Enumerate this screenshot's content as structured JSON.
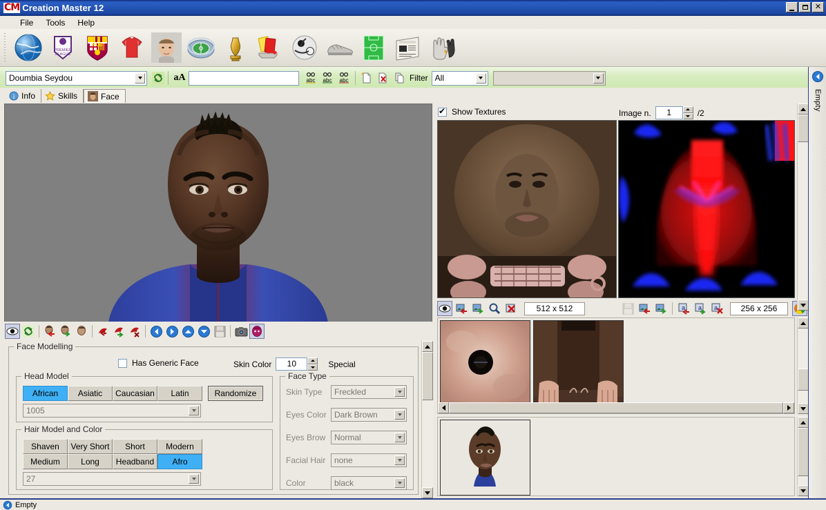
{
  "window": {
    "title": "Creation Master 12",
    "logo": "CM",
    "buttons": {
      "minimize": "_",
      "maximize": "□",
      "close": "✕"
    }
  },
  "menu": {
    "items": [
      "File",
      "Tools",
      "Help"
    ]
  },
  "toolbar": {
    "items": [
      {
        "name": "globe-icon",
        "label": "World"
      },
      {
        "name": "league-icon",
        "label": "Premier League"
      },
      {
        "name": "club-crest-icon",
        "label": "FCB"
      },
      {
        "name": "jersey-icon",
        "label": "Kits"
      },
      {
        "name": "player-face-icon",
        "label": "Players"
      },
      {
        "name": "stadium-icon",
        "label": "Stadiums"
      },
      {
        "name": "trophy-icon",
        "label": "Trophies"
      },
      {
        "name": "cards-icon",
        "label": "Cards"
      },
      {
        "name": "ball-icon",
        "label": "Balls"
      },
      {
        "name": "boots-icon",
        "label": "Boots"
      },
      {
        "name": "pitch-icon",
        "label": "Pitch"
      },
      {
        "name": "news-icon",
        "label": "News"
      },
      {
        "name": "gloves-icon",
        "label": "Gloves"
      }
    ]
  },
  "selectbar": {
    "player_name": "Doumbia Seydou",
    "refresh_icon": "refresh-icon",
    "case_icon": "aA",
    "search_value": "",
    "find_icons": [
      "find-abc-icon",
      "find-next-abc-icon",
      "find-prev-abc-icon"
    ],
    "doc_icons": [
      "new-doc-icon",
      "delete-doc-icon",
      "copy-doc-icon"
    ],
    "filter_label": "Filter",
    "filter_value": "All",
    "secondary_filter_value": ""
  },
  "tabs": [
    {
      "label": "Info",
      "icon": "info-icon",
      "active": false
    },
    {
      "label": "Skills",
      "icon": "star-icon",
      "active": false
    },
    {
      "label": "Face",
      "icon": "face-icon",
      "active": true
    }
  ],
  "viewport": {
    "background_color": "#808080",
    "render_description": "3D player head render with mohawk hair and blue jersey"
  },
  "view_toolbar": {
    "buttons": [
      {
        "name": "preview-eye-icon",
        "pressed": true
      },
      {
        "name": "refresh-icon",
        "pressed": false
      },
      {
        "name": "import-head-icon",
        "pressed": false
      },
      {
        "name": "export-head-icon",
        "pressed": false
      },
      {
        "name": "reset-head-icon",
        "pressed": false
      },
      {
        "name": "import-hair-icon",
        "pressed": false
      },
      {
        "name": "export-hair-icon",
        "pressed": false
      },
      {
        "name": "delete-hair-icon",
        "pressed": false
      },
      {
        "name": "rotate-left-icon",
        "pressed": false
      },
      {
        "name": "rotate-right-icon",
        "pressed": false
      },
      {
        "name": "rotate-up-icon",
        "pressed": false
      },
      {
        "name": "rotate-down-icon",
        "pressed": false
      },
      {
        "name": "save-icon",
        "pressed": false
      },
      {
        "name": "camera-icon",
        "pressed": false
      },
      {
        "name": "head-color-icon",
        "pressed": true
      }
    ]
  },
  "face_modelling": {
    "title": "Face Modelling",
    "has_generic_face": {
      "label": "Has Generic Face",
      "checked": false
    },
    "skin_color": {
      "label": "Skin Color",
      "value": "10"
    },
    "special_label": "Special",
    "head_model": {
      "title": "Head Model",
      "options": [
        "African",
        "Asiatic",
        "Caucasian",
        "Latin"
      ],
      "selected": "African",
      "randomize_label": "Randomize",
      "model_id": "1005"
    },
    "hair_model": {
      "title": "Hair Model and Color",
      "options": [
        "Shaven",
        "Very Short",
        "Short",
        "Modern",
        "Medium",
        "Long",
        "Headband",
        "Afro"
      ],
      "selected": "Afro",
      "color_id": "27"
    },
    "face_type": {
      "title": "Face Type",
      "fields": [
        {
          "label": "Skin Type",
          "value": "Freckled"
        },
        {
          "label": "Eyes Color",
          "value": "Dark Brown"
        },
        {
          "label": "Eyes Brow",
          "value": "Normal"
        },
        {
          "label": "Facial Hair",
          "value": "none"
        },
        {
          "label": "Color",
          "value": "black"
        }
      ]
    }
  },
  "textures": {
    "show_textures": {
      "label": "Show Textures",
      "checked": true
    },
    "image_number": {
      "label": "Image n.",
      "value": "1",
      "total": "/2"
    },
    "left_texture": {
      "name": "face-diffuse-texture",
      "size": "512 x 512",
      "toolbar": [
        "preview-eye-icon",
        "import-texture-icon",
        "export-texture-icon",
        "zoom-texture-icon",
        "delete-texture-icon"
      ]
    },
    "right_texture": {
      "name": "face-normal-map-texture",
      "size": "256 x 256",
      "toolbar": [
        "save-icon",
        "import-texture-icon",
        "export-texture-icon",
        "import-alpha-icon",
        "export-alpha-icon",
        "delete-alpha-icon"
      ],
      "palette_icon": "palette-icon"
    },
    "thumbnails": [
      {
        "name": "eye-texture-thumb"
      },
      {
        "name": "hands-texture-thumb"
      }
    ],
    "preview_thumbnails": [
      {
        "name": "face-preview-thumb"
      }
    ]
  },
  "dock": {
    "label": "Empty",
    "back_icon": "back-arrow-icon"
  },
  "statusbar": {
    "text": "Empty",
    "icon": "back-arrow-icon"
  },
  "colors": {
    "titlebar": "#1f4aa8",
    "accent_select": "#3fb0f5",
    "toolbar_green": "#cde8b0",
    "viewport_gray": "#808080",
    "panel": "#ece9e2"
  }
}
